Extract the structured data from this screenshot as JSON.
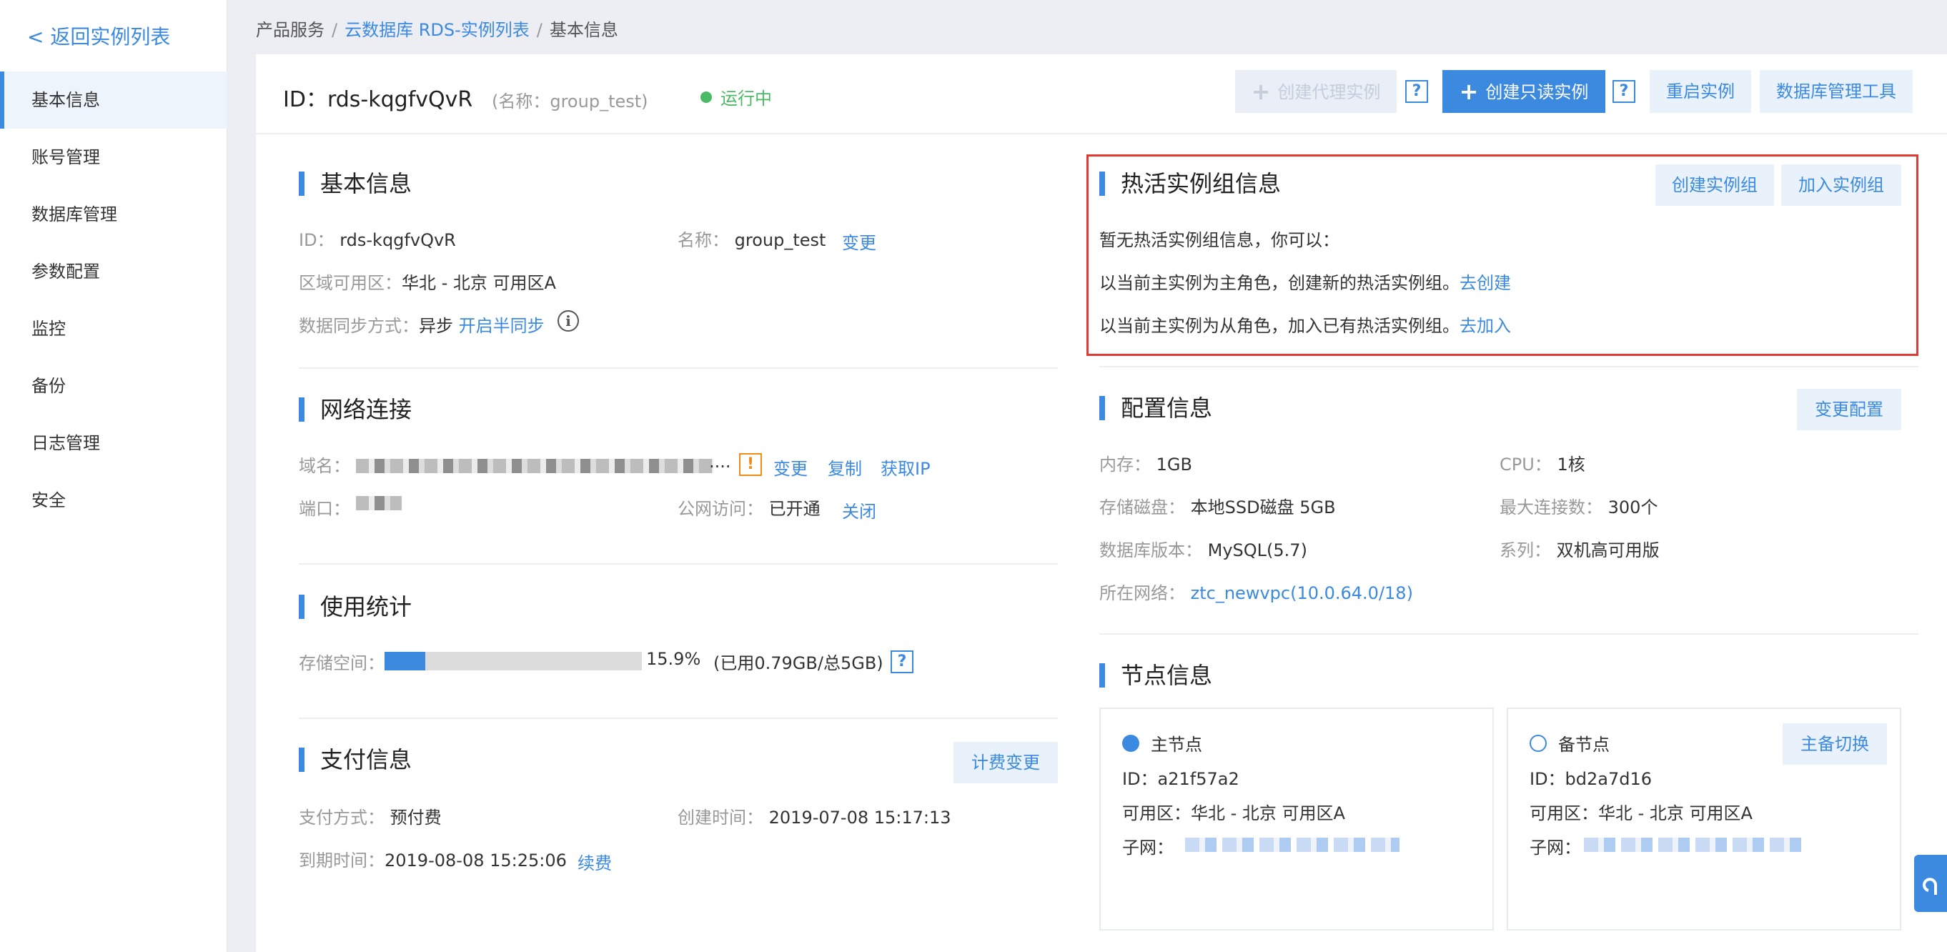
{
  "sidebar": {
    "back_label": "< 返回实例列表",
    "items": [
      {
        "label": "基本信息",
        "active": true
      },
      {
        "label": "账号管理"
      },
      {
        "label": "数据库管理"
      },
      {
        "label": "参数配置"
      },
      {
        "label": "监控"
      },
      {
        "label": "备份"
      },
      {
        "label": "日志管理"
      },
      {
        "label": "安全"
      }
    ]
  },
  "breadcrumb": {
    "root": "产品服务",
    "middle": "云数据库 RDS-实例列表",
    "current": "基本信息",
    "sep": "/"
  },
  "header": {
    "instance_id": "ID：rds-kqgfvQvR",
    "instance_name": "(名称：group_test)",
    "status": "运行中",
    "btn_proxy": "创建代理实例",
    "btn_readonly": "创建只读实例",
    "btn_restart": "重启实例",
    "btn_dbtool": "数据库管理工具",
    "help": "?",
    "plus": "+"
  },
  "basic": {
    "title": "基本信息",
    "id_key": "ID：",
    "id_val": "rds-kqgfvQvR",
    "name_key": "名称：",
    "name_val": "group_test",
    "name_change": "变更",
    "zone_key": "区域可用区：",
    "zone_val": "华北 - 北京 可用区A",
    "sync_key": "数据同步方式：",
    "sync_val": "异步",
    "sync_link": "开启半同步",
    "info": "i"
  },
  "network": {
    "title": "网络连接",
    "domain_key": "域名：",
    "domain_ellipsis": "....",
    "warn": "!",
    "change": "变更",
    "copy": "复制",
    "get_ip": "获取IP",
    "port_key": "端口：",
    "public_key": "公网访问：",
    "public_val": "已开通",
    "close": "关闭"
  },
  "usage": {
    "title": "使用统计",
    "storage_key": "存储空间：",
    "percent_text": "15.9%",
    "percent_value": 15.9,
    "detail": "(已用0.79GB/总5GB)",
    "help": "?"
  },
  "payment": {
    "title": "支付信息",
    "btn_change": "计费变更",
    "method_key": "支付方式：",
    "method_val": "预付费",
    "created_key": "创建时间：",
    "created_val": "2019-07-08 15:17:13",
    "expire_key": "到期时间：",
    "expire_val": "2019-08-08 15:25:06",
    "renew": "续费"
  },
  "hotgroup": {
    "title": "热活实例组信息",
    "btn_create": "创建实例组",
    "btn_join": "加入实例组",
    "line1": "暂无热活实例组信息，你可以：",
    "line2": "以当前主实例为主角色，创建新的热活实例组。",
    "line2_link": "去创建",
    "line3": "以当前主实例为从角色，加入已有热活实例组。",
    "line3_link": "去加入"
  },
  "config": {
    "title": "配置信息",
    "btn_change": "变更配置",
    "mem_key": "内存：",
    "mem_val": "1GB",
    "cpu_key": "CPU：",
    "cpu_val": "1核",
    "disk_key": "存储磁盘：",
    "disk_val": "本地SSD磁盘 5GB",
    "maxconn_key": "最大连接数：",
    "maxconn_val": "300个",
    "ver_key": "数据库版本：",
    "ver_val": "MySQL(5.7)",
    "series_key": "系列：",
    "series_val": "双机高可用版",
    "net_key": "所在网络：",
    "net_val": "ztc_newvpc(10.0.64.0/18)"
  },
  "nodes": {
    "title": "节点信息",
    "primary_label": "主节点",
    "primary_id": "ID：a21f57a2",
    "primary_zone": "可用区：华北 - 北京 可用区A",
    "subnet_key": "子网：",
    "standby_label": "备节点",
    "standby_id": "ID：bd2a7d16",
    "standby_zone": "可用区：华北 - 北京 可用区A",
    "btn_switch": "主备切换"
  }
}
